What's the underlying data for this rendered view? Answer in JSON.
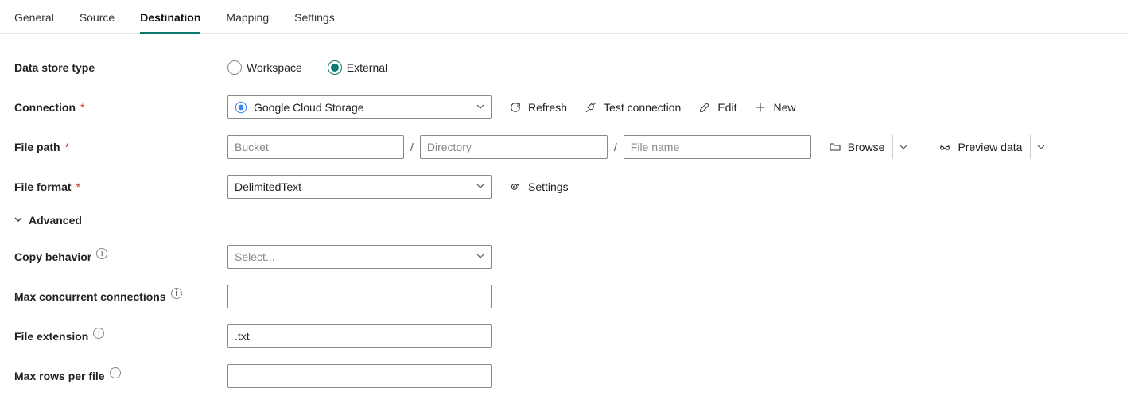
{
  "tabs": {
    "general": {
      "label": "General"
    },
    "source": {
      "label": "Source"
    },
    "destination": {
      "label": "Destination"
    },
    "mapping": {
      "label": "Mapping"
    },
    "settings": {
      "label": "Settings"
    },
    "active": "destination"
  },
  "labels": {
    "data_store_type": "Data store type",
    "connection": "Connection",
    "file_path": "File path",
    "file_format": "File format",
    "advanced": "Advanced",
    "copy_behavior": "Copy behavior",
    "max_conn": "Max concurrent connections",
    "file_ext": "File extension",
    "max_rows": "Max rows per file"
  },
  "data_store_type": {
    "options": {
      "workspace": "Workspace",
      "external": "External"
    },
    "selected": "external"
  },
  "connection": {
    "value": "Google Cloud Storage",
    "actions": {
      "refresh": "Refresh",
      "test": "Test connection",
      "edit": "Edit",
      "new": "New"
    }
  },
  "file_path": {
    "bucket_placeholder": "Bucket",
    "directory_placeholder": "Directory",
    "filename_placeholder": "File name",
    "bucket_value": "",
    "directory_value": "",
    "filename_value": "",
    "browse": "Browse",
    "preview": "Preview data"
  },
  "file_format": {
    "value": "DelimitedText",
    "settings_label": "Settings"
  },
  "advanced_open": true,
  "copy_behavior": {
    "value": "",
    "placeholder": "Select..."
  },
  "max_conn": {
    "value": ""
  },
  "file_ext": {
    "value": ".txt"
  },
  "max_rows": {
    "value": ""
  }
}
